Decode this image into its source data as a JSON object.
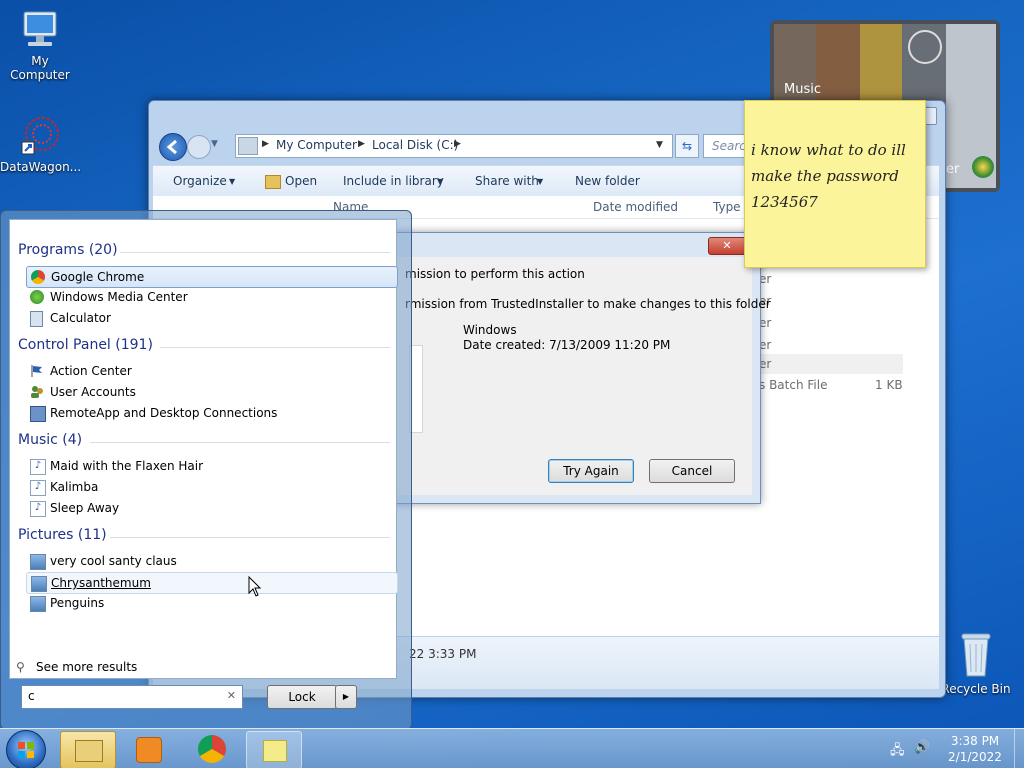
{
  "desktop": {
    "icons": [
      {
        "label": "My Computer",
        "icon": "computer-icon"
      },
      {
        "label": "DataWagon...",
        "icon": "datawagon-icon"
      },
      {
        "label": "Recycle Bin",
        "icon": "recycle-bin-icon"
      }
    ]
  },
  "gadget": {
    "label": "Music",
    "partial_label": "er"
  },
  "sticky_note": {
    "line1": "i know what to do ill",
    "line2": "make the password",
    "line3": "1234567"
  },
  "explorer": {
    "breadcrumb": [
      "My Computer",
      "Local Disk (C:)"
    ],
    "search_placeholder": "Search",
    "toolbar": [
      "Organize",
      "Open",
      "Include in library",
      "Share with",
      "New folder"
    ],
    "columns": [
      "Name",
      "Date modified",
      "Type"
    ],
    "row_partial": [
      "er",
      "er",
      "er",
      "er",
      "er"
    ],
    "file_row": {
      "type": "s Batch File",
      "size": "1 KB"
    },
    "details_date": "22 3:33 PM"
  },
  "dialog": {
    "line1": "mission to perform this action",
    "line2": "rmission from TrustedInstaller to make changes to this folder",
    "folder_name": "Windows",
    "date_created": "Date created: 7/13/2009 11:20 PM",
    "try_again": "Try Again",
    "cancel": "Cancel"
  },
  "start_menu": {
    "groups": [
      {
        "title": "Programs (20)",
        "items": [
          "Google Chrome",
          "Windows Media Center",
          "Calculator"
        ]
      },
      {
        "title": "Control Panel (191)",
        "items": [
          "Action Center",
          "User Accounts",
          "RemoteApp and Desktop Connections"
        ]
      },
      {
        "title": "Music (4)",
        "items": [
          "Maid with the Flaxen Hair",
          "Kalimba",
          "Sleep Away"
        ]
      },
      {
        "title": "Pictures (11)",
        "items": [
          "very cool santy claus",
          "Chrysanthemum",
          "Penguins"
        ]
      }
    ],
    "see_more": "See more results",
    "search_value": "c",
    "lock_label": "Lock"
  },
  "taskbar": {
    "time": "3:38 PM",
    "date": "2/1/2022"
  },
  "colors": {
    "accent": "#1e3287",
    "note": "#fcf49a"
  }
}
